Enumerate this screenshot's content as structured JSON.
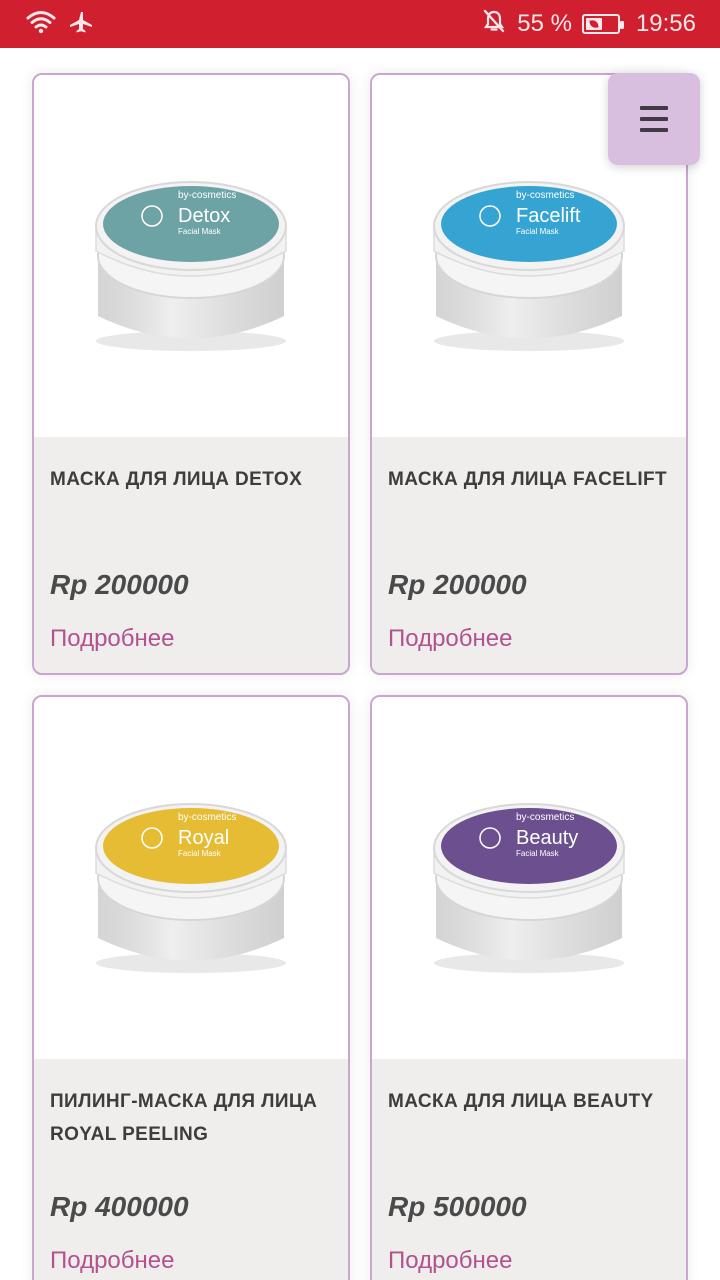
{
  "status_bar": {
    "battery_percent": "55 %",
    "time": "19:56",
    "icons": [
      "wifi-icon",
      "airplane-icon",
      "bell-off-icon",
      "battery-icon"
    ]
  },
  "menu": {
    "icon": "hamburger-menu-icon"
  },
  "products": [
    {
      "title": "МАСКА ДЛЯ ЛИЦА DETOX",
      "price": "Rp 200000",
      "link": "Подробнее",
      "jar": {
        "brand": "by-cosmetics",
        "name": "Detox",
        "sub": "Facial Mask",
        "color": "#6ea3a6"
      }
    },
    {
      "title": "МАСКА ДЛЯ ЛИЦА FACELIFT",
      "price": "Rp 200000",
      "link": "Подробнее",
      "jar": {
        "brand": "by-cosmetics",
        "name": "Facelift",
        "sub": "Facial Mask",
        "color": "#35a4d2"
      }
    },
    {
      "title": "ПИЛИНГ-МАСКА ДЛЯ ЛИЦА ROYAL PEELING",
      "price": "Rp 400000",
      "link": "Подробнее",
      "jar": {
        "brand": "by-cosmetics",
        "name": "Royal",
        "sub": "Facial Mask",
        "color": "#e5bc34"
      }
    },
    {
      "title": "МАСКА ДЛЯ ЛИЦА BEAUTY",
      "price": "Rp 500000",
      "link": "Подробнее",
      "jar": {
        "brand": "by-cosmetics",
        "name": "Beauty",
        "sub": "Facial Mask",
        "color": "#6c4f8f"
      }
    }
  ],
  "colors": {
    "status_bar": "#d0202f",
    "card_border": "#c9a5d0",
    "link": "#b2528f",
    "menu_button": "#d8bfdf"
  }
}
